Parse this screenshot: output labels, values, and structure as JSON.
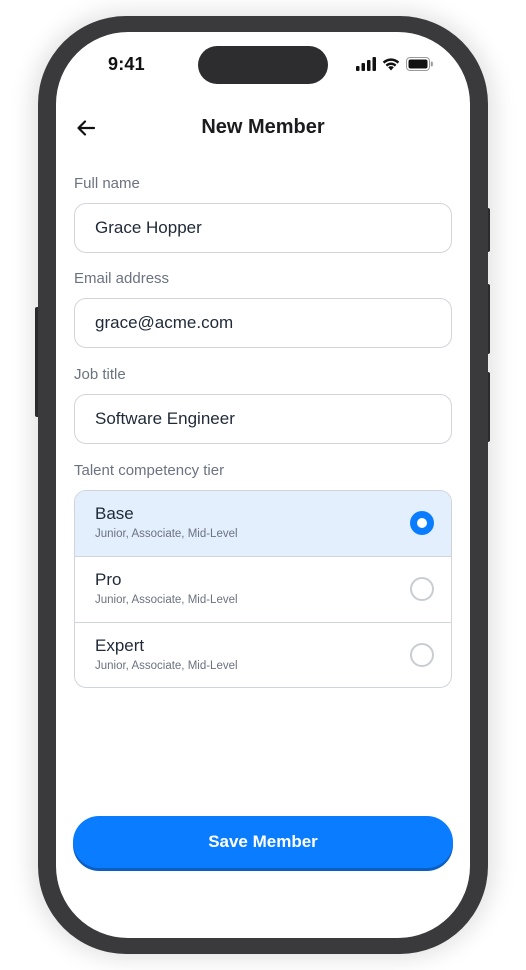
{
  "status_bar": {
    "time": "9:41"
  },
  "header": {
    "title": "New Member"
  },
  "form": {
    "full_name": {
      "label": "Full name",
      "value": "Grace Hopper"
    },
    "email": {
      "label": "Email address",
      "value": "grace@acme.com"
    },
    "job_title": {
      "label": "Job title",
      "value": "Software Engineer"
    },
    "tier": {
      "label": "Talent competency tier",
      "options": [
        {
          "name": "Base",
          "description": "Junior, Associate, Mid-Level",
          "selected": true
        },
        {
          "name": "Pro",
          "description": "Junior, Associate, Mid-Level",
          "selected": false
        },
        {
          "name": "Expert",
          "description": "Junior, Associate, Mid-Level",
          "selected": false
        }
      ]
    }
  },
  "actions": {
    "save_label": "Save Member"
  },
  "colors": {
    "accent": "#0a7cff",
    "selected_bg": "#e3effd",
    "border": "#d1d5db",
    "label": "#6b7280"
  },
  "icons": {
    "back": "arrow-left-icon",
    "signal": "cellular-signal-icon",
    "wifi": "wifi-icon",
    "battery": "battery-icon"
  }
}
